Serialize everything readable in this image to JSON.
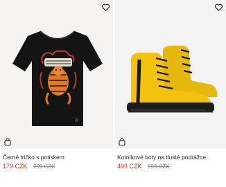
{
  "products": [
    {
      "name": "Černé tričko s potiskem",
      "price": "179 CZK",
      "old_price": "299 CZK",
      "image_icon": "black-tiger-tshirt-image",
      "wishlist_icon": "heart-icon",
      "bag_icon": "shopping-bag-icon"
    },
    {
      "name": "Kotníkové boty na tlusté podrážce",
      "price": "499 CZK",
      "old_price": "999 CZK",
      "image_icon": "yellow-boots-image",
      "wishlist_icon": "heart-icon",
      "bag_icon": "shopping-bag-icon"
    }
  ],
  "colors": {
    "price": "#e53127",
    "old_price": "#8a8a8a",
    "boot_yellow": "#f2c20f"
  }
}
